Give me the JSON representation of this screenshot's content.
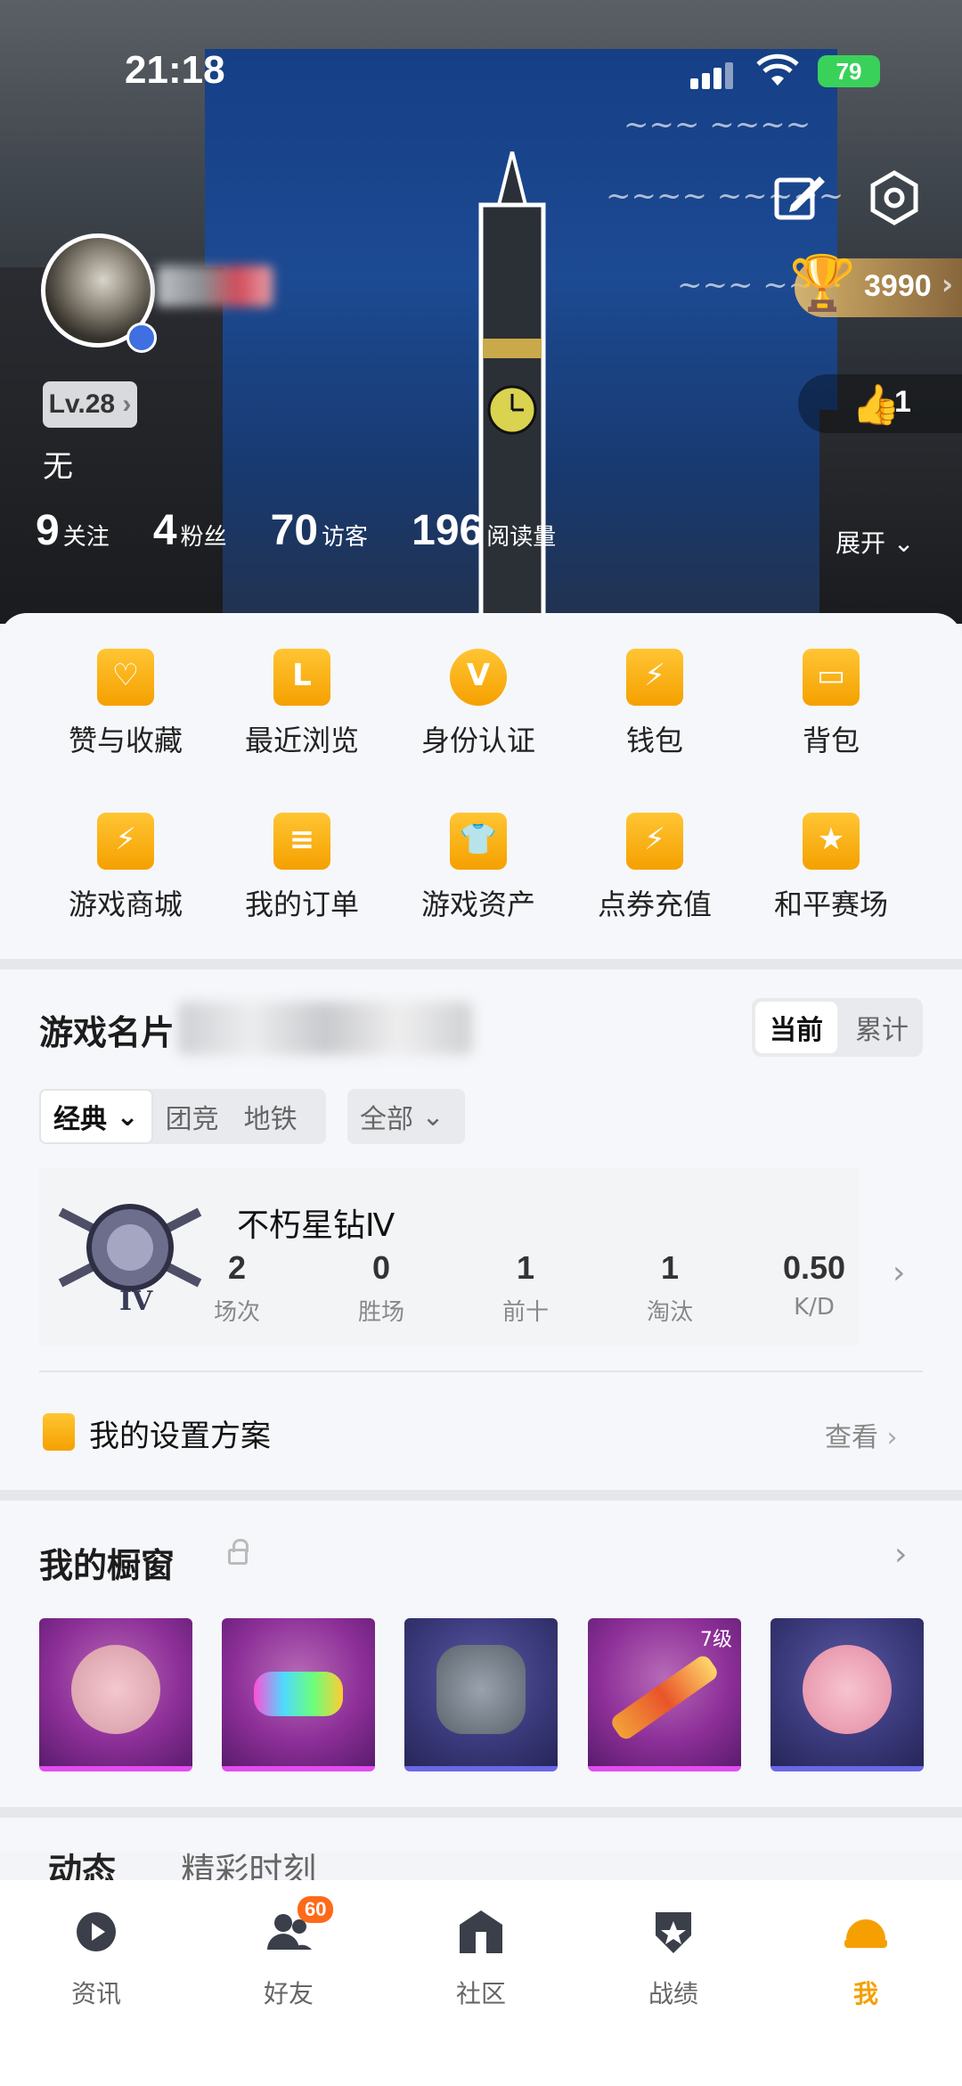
{
  "status_bar": {
    "time": "21:18",
    "battery": "79"
  },
  "profile": {
    "level": "Lv.28",
    "bio": "无",
    "trophy_count": "3990",
    "likes_count": "1",
    "stats": [
      {
        "value": "9",
        "label": "关注"
      },
      {
        "value": "4",
        "label": "粉丝"
      },
      {
        "value": "70",
        "label": "访客"
      },
      {
        "value": "196",
        "label": "阅读量"
      }
    ],
    "expand_label": "展开"
  },
  "grid": [
    {
      "label": "赞与收藏",
      "icon": "bookmark-heart-icon"
    },
    {
      "label": "最近浏览",
      "icon": "folder-clock-icon"
    },
    {
      "label": "身份认证",
      "icon": "verified-badge-icon"
    },
    {
      "label": "钱包",
      "icon": "wallet-icon"
    },
    {
      "label": "背包",
      "icon": "backpack-icon"
    },
    {
      "label": "游戏商城",
      "icon": "shopping-bag-icon"
    },
    {
      "label": "我的订单",
      "icon": "order-list-icon"
    },
    {
      "label": "游戏资产",
      "icon": "tshirt-icon"
    },
    {
      "label": "点券充值",
      "icon": "coupon-cards-icon"
    },
    {
      "label": "和平赛场",
      "icon": "trophy-cup-icon"
    }
  ],
  "game_card": {
    "title": "游戏名片",
    "toggle": [
      "当前",
      "累计"
    ],
    "modes": [
      "经典",
      "团竞",
      "地铁"
    ],
    "filter": "全部",
    "rank_name": "不朽星钻Ⅳ",
    "stats": [
      {
        "value": "2",
        "label": "场次"
      },
      {
        "value": "0",
        "label": "胜场"
      },
      {
        "value": "1",
        "label": "前十"
      },
      {
        "value": "1",
        "label": "淘汰"
      },
      {
        "value": "0.50",
        "label": "K/D"
      }
    ]
  },
  "settings": {
    "label": "我的设置方案",
    "link": "查看"
  },
  "showcase": {
    "title": "我的橱窗",
    "item_tag": "7级"
  },
  "feed_tabs": [
    "动态",
    "精彩时刻"
  ],
  "bottom_nav": [
    {
      "label": "资讯",
      "icon": "news-play-icon"
    },
    {
      "label": "好友",
      "icon": "friends-icon"
    },
    {
      "label": "社区",
      "icon": "community-icon"
    },
    {
      "label": "战绩",
      "icon": "record-shield-icon"
    },
    {
      "label": "我",
      "icon": "helmet-icon"
    }
  ],
  "friends_badge": "60",
  "colors": {
    "accent": "#f5a000",
    "text": "#1f1f1f"
  }
}
